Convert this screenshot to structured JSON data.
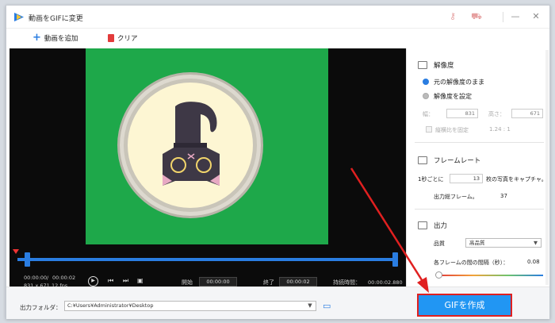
{
  "window": {
    "title": "動画をGIFに変更"
  },
  "toolbar": {
    "add_label": "動画を追加",
    "clear_label": "クリア"
  },
  "player": {
    "current_time": "00:00:00",
    "separator": "/",
    "total_time": "00:00:02",
    "resolution_info": "831 x 671",
    "fps_info": "12 fps",
    "start_label": "開始",
    "start_value": "00:00:00",
    "end_label": "終了",
    "end_value": "00:00:02",
    "duration_label": "持続時間：",
    "duration_value": "00:00:02.880"
  },
  "panel": {
    "resolution_title": "解像度",
    "keep_original_label": "元の解像度のまま",
    "set_resolution_label": "解像度を設定",
    "width_label": "幅：",
    "width_value": "831",
    "height_label": "高さ：",
    "height_value": "671",
    "aspect_label": "縦横比を固定",
    "aspect_value": "1.24 : 1",
    "framerate_title": "フレームレート",
    "per_second_label": "1秒ごとに",
    "per_second_value": "13",
    "capture_label": "枚の写真をキャプチャ。",
    "total_frames_label": "出力総フレーム。",
    "total_frames_value": "37",
    "output_title": "出力",
    "quality_label": "品質",
    "quality_value": "高品質",
    "interval_label": "各フレームの間の間隔（秒）：",
    "interval_value": "0.08"
  },
  "bottom": {
    "folder_label": "出力フォルダ：",
    "folder_path": "C:¥Users¥Administrator¥Desktop",
    "create_gif_label": "GIFを作成"
  },
  "colors": {
    "accent": "#2196f3",
    "highlight_border": "#e02020",
    "video_bg": "#1ea84a"
  }
}
